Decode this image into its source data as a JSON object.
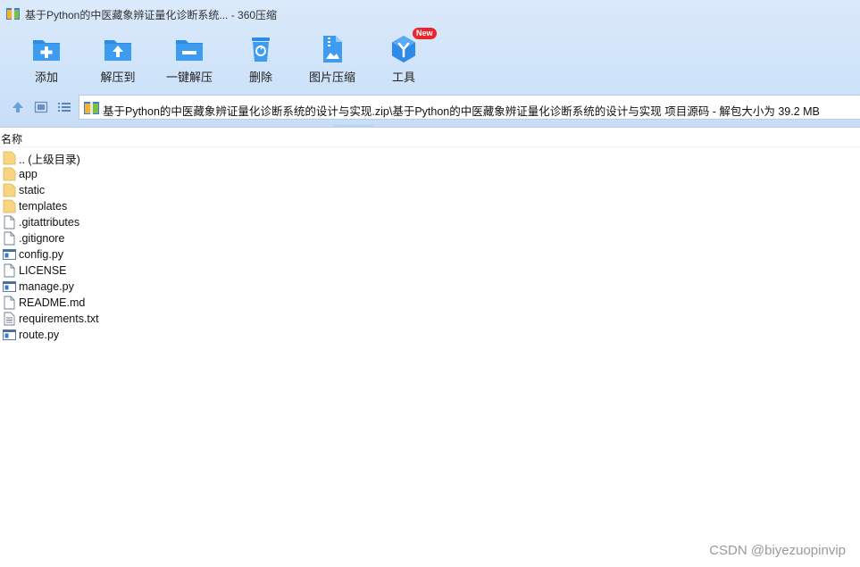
{
  "window": {
    "title": "基于Python的中医藏象辨证量化诊断系统... - 360压缩"
  },
  "toolbar": {
    "items": [
      {
        "label": "添加",
        "icon": "add-icon"
      },
      {
        "label": "解压到",
        "icon": "extract-to-icon"
      },
      {
        "label": "一键解压",
        "icon": "one-click-extract-icon"
      },
      {
        "label": "删除",
        "icon": "delete-icon"
      },
      {
        "label": "图片压缩",
        "icon": "image-compress-icon"
      },
      {
        "label": "工具",
        "icon": "tools-icon",
        "badge": "New"
      }
    ],
    "accent": "#2b8be6",
    "badge_color": "#e8262e"
  },
  "address": {
    "path": "基于Python的中医藏象辨证量化诊断系统的设计与实现.zip\\基于Python的中医藏象辨证量化诊断系统的设计与实现 项目源码 - 解包大小为 39.2 MB"
  },
  "list": {
    "column_name": "名称",
    "items": [
      {
        "name": ".. (上级目录)",
        "type": "folder"
      },
      {
        "name": "app",
        "type": "folder"
      },
      {
        "name": "static",
        "type": "folder"
      },
      {
        "name": "templates",
        "type": "folder"
      },
      {
        "name": ".gitattributes",
        "type": "file"
      },
      {
        "name": ".gitignore",
        "type": "file"
      },
      {
        "name": "config.py",
        "type": "py"
      },
      {
        "name": "LICENSE",
        "type": "file"
      },
      {
        "name": "manage.py",
        "type": "py"
      },
      {
        "name": "README.md",
        "type": "file"
      },
      {
        "name": "requirements.txt",
        "type": "text"
      },
      {
        "name": "route.py",
        "type": "py"
      }
    ]
  },
  "watermark": "CSDN @biyezuopinvip"
}
